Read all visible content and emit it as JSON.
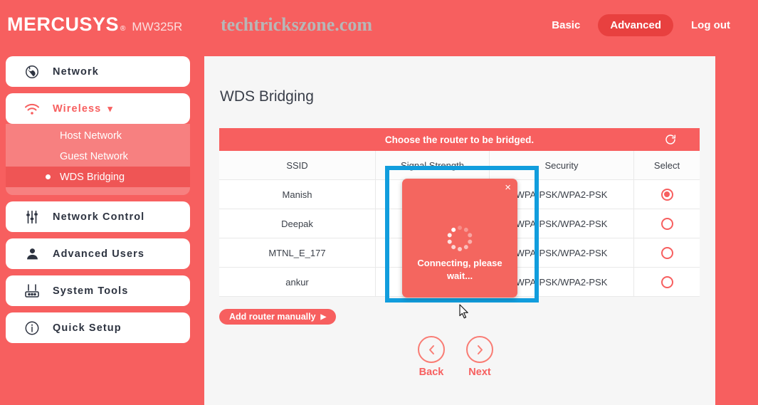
{
  "header": {
    "brand": "MERCUSYS",
    "brand_mark": "®",
    "model": "MW325R",
    "watermark": "techtrickszone.com",
    "nav": [
      {
        "label": "Basic",
        "active": false
      },
      {
        "label": "Advanced",
        "active": true
      },
      {
        "label": "Log out",
        "active": false
      }
    ]
  },
  "sidebar": {
    "items": [
      {
        "label": "Network",
        "icon": "globe-icon",
        "expanded": false
      },
      {
        "label": "Wireless",
        "icon": "wifi-icon",
        "expanded": true
      },
      {
        "label": "Network Control",
        "icon": "sliders-icon",
        "expanded": false
      },
      {
        "label": "Advanced Users",
        "icon": "user-icon",
        "expanded": false
      },
      {
        "label": "System Tools",
        "icon": "router-icon",
        "expanded": false
      },
      {
        "label": "Quick Setup",
        "icon": "info-icon",
        "expanded": false
      }
    ],
    "submenu": [
      {
        "label": "Host Network",
        "current": false
      },
      {
        "label": "Guest Network",
        "current": false
      },
      {
        "label": "WDS Bridging",
        "current": true
      }
    ]
  },
  "main": {
    "page_title": "WDS Bridging",
    "table": {
      "banner": "Choose the router to be bridged.",
      "refresh_icon": "refresh-icon",
      "columns": [
        "SSID",
        "Signal Strength",
        "Security",
        "Select"
      ],
      "rows": [
        {
          "ssid": "Manish",
          "signal": "",
          "security": "WPA-PSK/WPA2-PSK",
          "selected": true
        },
        {
          "ssid": "Deepak",
          "signal": "",
          "security": "WPA-PSK/WPA2-PSK",
          "selected": false
        },
        {
          "ssid": "MTNL_E_177",
          "signal": "",
          "security": "WPA-PSK/WPA2-PSK",
          "selected": false
        },
        {
          "ssid": "ankur",
          "signal": "",
          "security": "WPA-PSK/WPA2-PSK",
          "selected": false
        }
      ]
    },
    "add_router_label": "Add router manually",
    "add_router_arrow": "▶",
    "pager": [
      {
        "label": "Back",
        "glyph": "‹",
        "icon": "chevron-left-icon"
      },
      {
        "label": "Next",
        "glyph": "›",
        "icon": "chevron-right-icon"
      }
    ]
  },
  "modal": {
    "message": "Connecting, please wait...",
    "close_glyph": "×"
  },
  "colors": {
    "brand_red": "#f75f5f",
    "deep_red": "#e8403f",
    "submenu_red": "#f78080",
    "submenu_active": "#ef5555",
    "modal_red": "#f4665f",
    "annotation_blue": "#119ddd",
    "panel_bg": "#f6f6f6",
    "text_dark": "#3b4049"
  }
}
